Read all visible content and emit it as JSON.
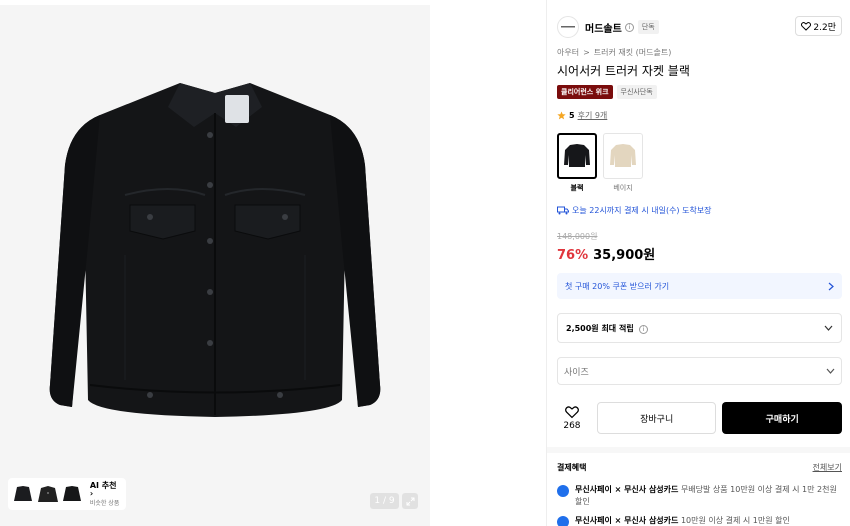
{
  "gallery": {
    "ai": {
      "title": "AI 추천",
      "subtitle": "비슷한 상품"
    },
    "pager": "1 / 9"
  },
  "brand": {
    "name": "머드솔트",
    "tag": "단독",
    "likes": "2.2만"
  },
  "breadcrumbs": [
    "아우터",
    ">",
    "트러커 재킷 (머드솔트)"
  ],
  "product": {
    "title": "시어서커 트러커 자켓 블랙",
    "badge_primary": "클리어런스 위크",
    "badge_secondary": "무신사단독",
    "rating": "5",
    "reviews": "후기 9개"
  },
  "colors": [
    {
      "label": "블랙",
      "selected": true
    },
    {
      "label": "베이지",
      "selected": false
    }
  ],
  "delivery": "오늘 22시까지 결제 시 내일(수) 도착보장",
  "pricing": {
    "original": "148,000원",
    "discount": "76%",
    "price": "35,900원"
  },
  "coupon": {
    "label": "첫 구매 20% 쿠폰 받으러 가기"
  },
  "points": {
    "label": "2,500원 최대 적립"
  },
  "size": {
    "placeholder": "사이즈"
  },
  "actions": {
    "like_count": "268",
    "cart": "장바구니",
    "buy": "구매하기"
  },
  "payment": {
    "header": "결제혜택",
    "view_all": "전체보기",
    "benefits": [
      {
        "name": "무신사페이 × 무신사 삼성카드",
        "desc": "무배당발 상품 10만원 이상 결제 시 1만 2천원 할인"
      },
      {
        "name": "무신사페이 × 무신사 삼성카드",
        "desc": "10만원 이상 결제 시 1만원 할인"
      }
    ]
  },
  "colors_theme": {
    "accent_blue": "#2354d8",
    "discount_red": "#e0353c",
    "badge_red": "#7a0c0c",
    "star": "#f5a623"
  }
}
